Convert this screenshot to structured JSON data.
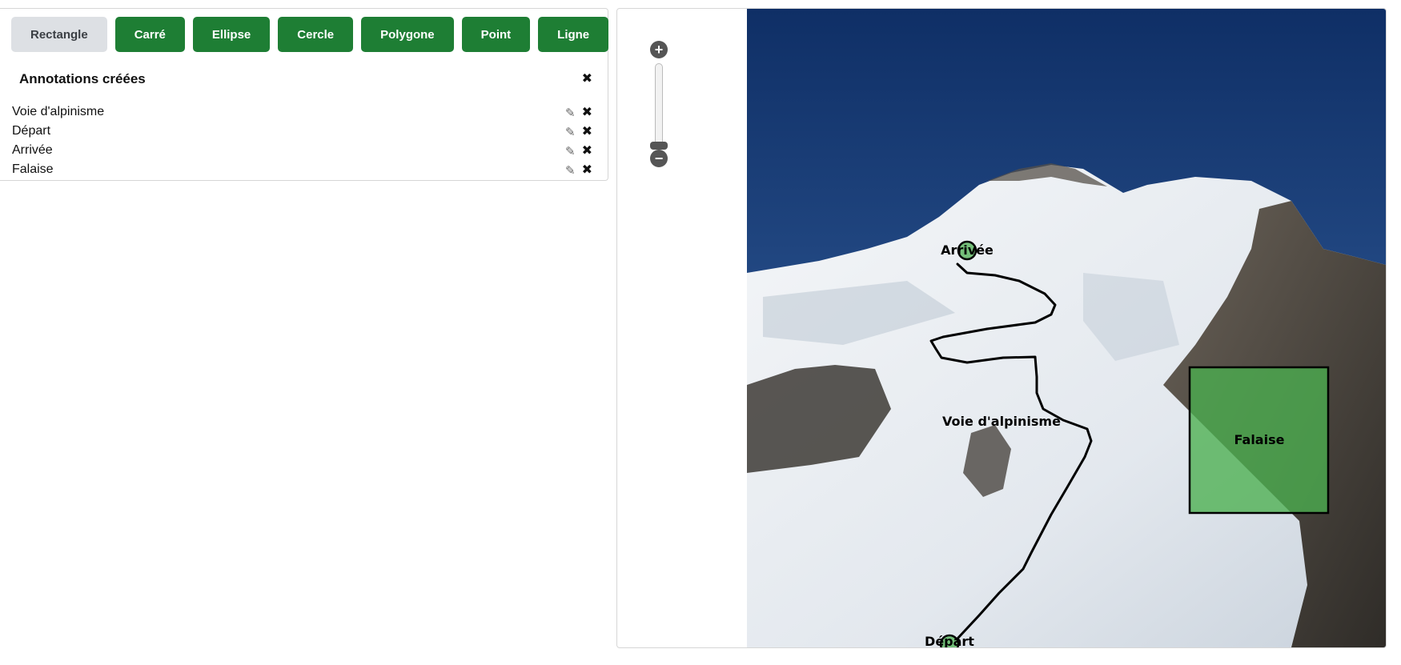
{
  "toolbar": {
    "buttons": [
      {
        "label": "Rectangle",
        "active": true
      },
      {
        "label": "Carré",
        "active": false
      },
      {
        "label": "Ellipse",
        "active": false
      },
      {
        "label": "Cercle",
        "active": false
      },
      {
        "label": "Polygone",
        "active": false
      },
      {
        "label": "Point",
        "active": false
      },
      {
        "label": "Ligne",
        "active": false
      }
    ]
  },
  "annotations_panel": {
    "title": "Annotations créées",
    "close_icon": "close-icon",
    "items": [
      {
        "label": "Voie d'alpinisme",
        "edit_icon": "pencil-icon",
        "delete_icon": "close-icon"
      },
      {
        "label": "Départ",
        "edit_icon": "pencil-icon",
        "delete_icon": "close-icon"
      },
      {
        "label": "Arrivée",
        "edit_icon": "pencil-icon",
        "delete_icon": "close-icon"
      },
      {
        "label": "Falaise",
        "edit_icon": "pencil-icon",
        "delete_icon": "close-icon"
      }
    ]
  },
  "viewer": {
    "zoom_in_icon": "plus-icon",
    "zoom_out_icon": "minus-icon",
    "zoom_level": 0.0,
    "image_annotations": {
      "route_label": "Voie d'alpinisme",
      "start_label": "Départ",
      "end_label": "Arrivée",
      "cliff_label": "Falaise"
    }
  },
  "colors": {
    "button_green": "#1e7e34",
    "button_active": "#dde0e4",
    "annotation_fill": "#4caf50",
    "sky": "#1d3f7a"
  }
}
